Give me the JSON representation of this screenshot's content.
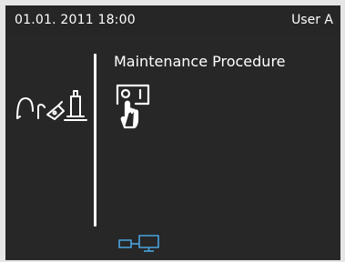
{
  "status_bar": {
    "datetime": "01.01. 2011 18:00",
    "user": "User A"
  },
  "main": {
    "title": "Maintenance Procedure",
    "procedure_icon": "maintenance-touch-icon",
    "device_icon": "handpiece-device-icon"
  },
  "footer": {
    "network_icon": "network-connection-icon"
  },
  "colors": {
    "background": "#272727",
    "text": "#ffffff",
    "network_accent": "#4aa3df"
  }
}
